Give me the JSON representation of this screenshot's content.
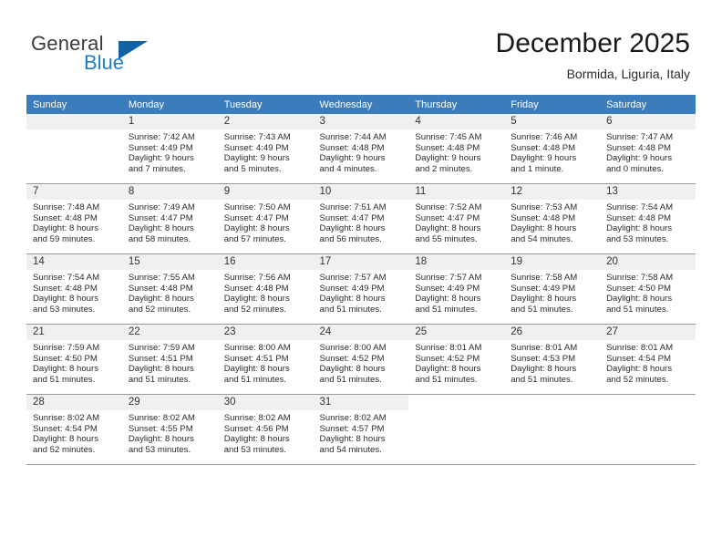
{
  "brand": {
    "line1": "General",
    "line2": "Blue",
    "triangle_color": "#1163a5",
    "blue_text_color": "#1f7fc4"
  },
  "header": {
    "title": "December 2025",
    "subtitle": "Bormida, Liguria, Italy"
  },
  "theme": {
    "header_row_bg": "#3b7cbd",
    "header_row_text": "#ffffff",
    "daynum_bg": "#f0f0f0",
    "grid_line": "#9a9a9a",
    "body_text": "#2b2b2b"
  },
  "weekdays": [
    "Sunday",
    "Monday",
    "Tuesday",
    "Wednesday",
    "Thursday",
    "Friday",
    "Saturday"
  ],
  "weeks": [
    [
      {
        "day": "",
        "sunrise": "",
        "sunset": "",
        "daylight1": "",
        "daylight2": "",
        "empty": true
      },
      {
        "day": "1",
        "sunrise": "Sunrise: 7:42 AM",
        "sunset": "Sunset: 4:49 PM",
        "daylight1": "Daylight: 9 hours",
        "daylight2": "and 7 minutes."
      },
      {
        "day": "2",
        "sunrise": "Sunrise: 7:43 AM",
        "sunset": "Sunset: 4:49 PM",
        "daylight1": "Daylight: 9 hours",
        "daylight2": "and 5 minutes."
      },
      {
        "day": "3",
        "sunrise": "Sunrise: 7:44 AM",
        "sunset": "Sunset: 4:48 PM",
        "daylight1": "Daylight: 9 hours",
        "daylight2": "and 4 minutes."
      },
      {
        "day": "4",
        "sunrise": "Sunrise: 7:45 AM",
        "sunset": "Sunset: 4:48 PM",
        "daylight1": "Daylight: 9 hours",
        "daylight2": "and 2 minutes."
      },
      {
        "day": "5",
        "sunrise": "Sunrise: 7:46 AM",
        "sunset": "Sunset: 4:48 PM",
        "daylight1": "Daylight: 9 hours",
        "daylight2": "and 1 minute."
      },
      {
        "day": "6",
        "sunrise": "Sunrise: 7:47 AM",
        "sunset": "Sunset: 4:48 PM",
        "daylight1": "Daylight: 9 hours",
        "daylight2": "and 0 minutes."
      }
    ],
    [
      {
        "day": "7",
        "sunrise": "Sunrise: 7:48 AM",
        "sunset": "Sunset: 4:48 PM",
        "daylight1": "Daylight: 8 hours",
        "daylight2": "and 59 minutes."
      },
      {
        "day": "8",
        "sunrise": "Sunrise: 7:49 AM",
        "sunset": "Sunset: 4:47 PM",
        "daylight1": "Daylight: 8 hours",
        "daylight2": "and 58 minutes."
      },
      {
        "day": "9",
        "sunrise": "Sunrise: 7:50 AM",
        "sunset": "Sunset: 4:47 PM",
        "daylight1": "Daylight: 8 hours",
        "daylight2": "and 57 minutes."
      },
      {
        "day": "10",
        "sunrise": "Sunrise: 7:51 AM",
        "sunset": "Sunset: 4:47 PM",
        "daylight1": "Daylight: 8 hours",
        "daylight2": "and 56 minutes."
      },
      {
        "day": "11",
        "sunrise": "Sunrise: 7:52 AM",
        "sunset": "Sunset: 4:47 PM",
        "daylight1": "Daylight: 8 hours",
        "daylight2": "and 55 minutes."
      },
      {
        "day": "12",
        "sunrise": "Sunrise: 7:53 AM",
        "sunset": "Sunset: 4:48 PM",
        "daylight1": "Daylight: 8 hours",
        "daylight2": "and 54 minutes."
      },
      {
        "day": "13",
        "sunrise": "Sunrise: 7:54 AM",
        "sunset": "Sunset: 4:48 PM",
        "daylight1": "Daylight: 8 hours",
        "daylight2": "and 53 minutes."
      }
    ],
    [
      {
        "day": "14",
        "sunrise": "Sunrise: 7:54 AM",
        "sunset": "Sunset: 4:48 PM",
        "daylight1": "Daylight: 8 hours",
        "daylight2": "and 53 minutes."
      },
      {
        "day": "15",
        "sunrise": "Sunrise: 7:55 AM",
        "sunset": "Sunset: 4:48 PM",
        "daylight1": "Daylight: 8 hours",
        "daylight2": "and 52 minutes."
      },
      {
        "day": "16",
        "sunrise": "Sunrise: 7:56 AM",
        "sunset": "Sunset: 4:48 PM",
        "daylight1": "Daylight: 8 hours",
        "daylight2": "and 52 minutes."
      },
      {
        "day": "17",
        "sunrise": "Sunrise: 7:57 AM",
        "sunset": "Sunset: 4:49 PM",
        "daylight1": "Daylight: 8 hours",
        "daylight2": "and 51 minutes."
      },
      {
        "day": "18",
        "sunrise": "Sunrise: 7:57 AM",
        "sunset": "Sunset: 4:49 PM",
        "daylight1": "Daylight: 8 hours",
        "daylight2": "and 51 minutes."
      },
      {
        "day": "19",
        "sunrise": "Sunrise: 7:58 AM",
        "sunset": "Sunset: 4:49 PM",
        "daylight1": "Daylight: 8 hours",
        "daylight2": "and 51 minutes."
      },
      {
        "day": "20",
        "sunrise": "Sunrise: 7:58 AM",
        "sunset": "Sunset: 4:50 PM",
        "daylight1": "Daylight: 8 hours",
        "daylight2": "and 51 minutes."
      }
    ],
    [
      {
        "day": "21",
        "sunrise": "Sunrise: 7:59 AM",
        "sunset": "Sunset: 4:50 PM",
        "daylight1": "Daylight: 8 hours",
        "daylight2": "and 51 minutes."
      },
      {
        "day": "22",
        "sunrise": "Sunrise: 7:59 AM",
        "sunset": "Sunset: 4:51 PM",
        "daylight1": "Daylight: 8 hours",
        "daylight2": "and 51 minutes."
      },
      {
        "day": "23",
        "sunrise": "Sunrise: 8:00 AM",
        "sunset": "Sunset: 4:51 PM",
        "daylight1": "Daylight: 8 hours",
        "daylight2": "and 51 minutes."
      },
      {
        "day": "24",
        "sunrise": "Sunrise: 8:00 AM",
        "sunset": "Sunset: 4:52 PM",
        "daylight1": "Daylight: 8 hours",
        "daylight2": "and 51 minutes."
      },
      {
        "day": "25",
        "sunrise": "Sunrise: 8:01 AM",
        "sunset": "Sunset: 4:52 PM",
        "daylight1": "Daylight: 8 hours",
        "daylight2": "and 51 minutes."
      },
      {
        "day": "26",
        "sunrise": "Sunrise: 8:01 AM",
        "sunset": "Sunset: 4:53 PM",
        "daylight1": "Daylight: 8 hours",
        "daylight2": "and 51 minutes."
      },
      {
        "day": "27",
        "sunrise": "Sunrise: 8:01 AM",
        "sunset": "Sunset: 4:54 PM",
        "daylight1": "Daylight: 8 hours",
        "daylight2": "and 52 minutes."
      }
    ],
    [
      {
        "day": "28",
        "sunrise": "Sunrise: 8:02 AM",
        "sunset": "Sunset: 4:54 PM",
        "daylight1": "Daylight: 8 hours",
        "daylight2": "and 52 minutes."
      },
      {
        "day": "29",
        "sunrise": "Sunrise: 8:02 AM",
        "sunset": "Sunset: 4:55 PM",
        "daylight1": "Daylight: 8 hours",
        "daylight2": "and 53 minutes."
      },
      {
        "day": "30",
        "sunrise": "Sunrise: 8:02 AM",
        "sunset": "Sunset: 4:56 PM",
        "daylight1": "Daylight: 8 hours",
        "daylight2": "and 53 minutes."
      },
      {
        "day": "31",
        "sunrise": "Sunrise: 8:02 AM",
        "sunset": "Sunset: 4:57 PM",
        "daylight1": "Daylight: 8 hours",
        "daylight2": "and 54 minutes."
      },
      {
        "day": "",
        "sunrise": "",
        "sunset": "",
        "daylight1": "",
        "daylight2": "",
        "blank": true
      },
      {
        "day": "",
        "sunrise": "",
        "sunset": "",
        "daylight1": "",
        "daylight2": "",
        "blank": true
      },
      {
        "day": "",
        "sunrise": "",
        "sunset": "",
        "daylight1": "",
        "daylight2": "",
        "blank": true
      }
    ]
  ]
}
